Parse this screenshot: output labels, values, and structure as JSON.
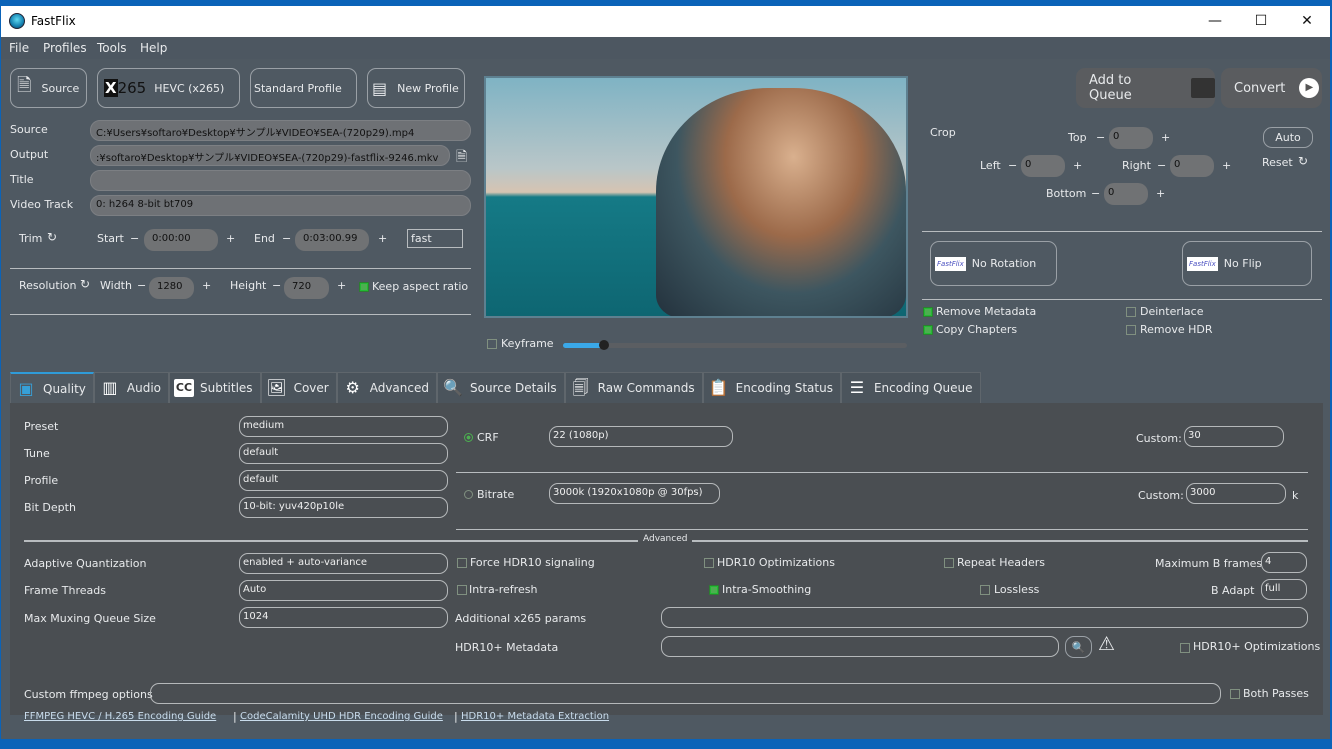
{
  "window": {
    "title": "FastFlix",
    "minimize": "—",
    "maximize": "☐",
    "close": "✕"
  },
  "menu": [
    "File",
    "Profiles",
    "Tools",
    "Help"
  ],
  "toolbar": {
    "source": "Source",
    "encoder_logo": "X265",
    "encoder": "HEVC (x265)",
    "profile": "Standard Profile",
    "new_profile": "New Profile",
    "add_to_queue": "Add to Queue",
    "convert": "Convert"
  },
  "fields": {
    "source_label": "Source",
    "source_value": "C:¥Users¥softaro¥Desktop¥サンプル¥VIDEO¥SEA-(720p29).mp4",
    "output_label": "Output",
    "output_value": ":¥softaro¥Desktop¥サンプル¥VIDEO¥SEA-(720p29)-fastflix-9246.mkv",
    "title_label": "Title",
    "title_value": "",
    "track_label": "Video Track",
    "track_value": "0: h264 8-bit bt709"
  },
  "trim": {
    "label": "Trim",
    "start_label": "Start",
    "start": "0:00:00",
    "end_label": "End",
    "end": "0:03:00.99",
    "mode": "fast",
    "minus": "−",
    "plus": "+"
  },
  "resolution": {
    "label": "Resolution",
    "width_label": "Width",
    "width": "1280",
    "height_label": "Height",
    "height": "720",
    "keep_aspect": "Keep aspect ratio",
    "keep_aspect_checked": true
  },
  "preview": {
    "keyframe": "Keyframe",
    "keyframe_checked": false,
    "position_percent": 12,
    "accent": "#3aa8e8"
  },
  "crop": {
    "label": "Crop",
    "top_label": "Top",
    "top": "0",
    "left_label": "Left",
    "left": "0",
    "right_label": "Right",
    "right": "0",
    "bottom_label": "Bottom",
    "bottom": "0",
    "auto": "Auto",
    "reset": "Reset"
  },
  "transform": {
    "logo": "FastFlix",
    "rotation": "No Rotation",
    "flip": "No Flip"
  },
  "options": [
    {
      "label": "Remove Metadata",
      "checked": true
    },
    {
      "label": "Copy Chapters",
      "checked": true
    },
    {
      "label": "Deinterlace",
      "checked": false
    },
    {
      "label": "Remove HDR",
      "checked": false
    }
  ],
  "tabs": [
    "Quality",
    "Audio",
    "Subtitles",
    "Cover",
    "Advanced",
    "Source Details",
    "Raw Commands",
    "Encoding Status",
    "Encoding Queue"
  ],
  "quality": {
    "left": [
      {
        "label": "Preset",
        "value": "medium"
      },
      {
        "label": "Tune",
        "value": "default"
      },
      {
        "label": "Profile",
        "value": "default"
      },
      {
        "label": "Bit Depth",
        "value": "10-bit: yuv420p10le"
      }
    ],
    "crf_label": "CRF",
    "crf_value": "22 (1080p)",
    "crf_custom_label": "Custom:",
    "crf_custom": "30",
    "crf_selected": true,
    "bitrate_label": "Bitrate",
    "bitrate_value": "3000k   (1920x1080p @ 30fps)",
    "bitrate_custom_label": "Custom:",
    "bitrate_custom": "3000",
    "bitrate_unit": "k",
    "advanced_label": "Advanced",
    "left2": [
      {
        "label": "Adaptive Quantization",
        "value": "enabled + auto-variance"
      },
      {
        "label": "Frame Threads",
        "value": "Auto"
      },
      {
        "label": "Max Muxing Queue Size",
        "value": "1024"
      }
    ],
    "checks": [
      {
        "label": "Force HDR10 signaling",
        "checked": false
      },
      {
        "label": "HDR10 Optimizations",
        "checked": false
      },
      {
        "label": "Repeat Headers",
        "checked": false
      },
      {
        "label": "Intra-refresh",
        "checked": false
      },
      {
        "label": "Intra-Smoothing",
        "checked": true
      },
      {
        "label": "Lossless",
        "checked": false
      }
    ],
    "max_b_label": "Maximum B frames",
    "max_b": "4",
    "b_adapt_label": "B Adapt",
    "b_adapt": "full",
    "x265_params_label": "Additional x265 params",
    "x265_params": "",
    "hdr10p_label": "HDR10+ Metadata",
    "hdr10p": "",
    "hdr10p_opt": "HDR10+ Optimizations",
    "ffmpeg_label": "Custom ffmpeg options",
    "ffmpeg": "",
    "both_passes": "Both Passes",
    "links": [
      "FFMPEG HEVC / H.265 Encoding Guide",
      "CodeCalamity UHD HDR Encoding Guide",
      "HDR10+ Metadata Extraction"
    ],
    "sep": "|"
  }
}
